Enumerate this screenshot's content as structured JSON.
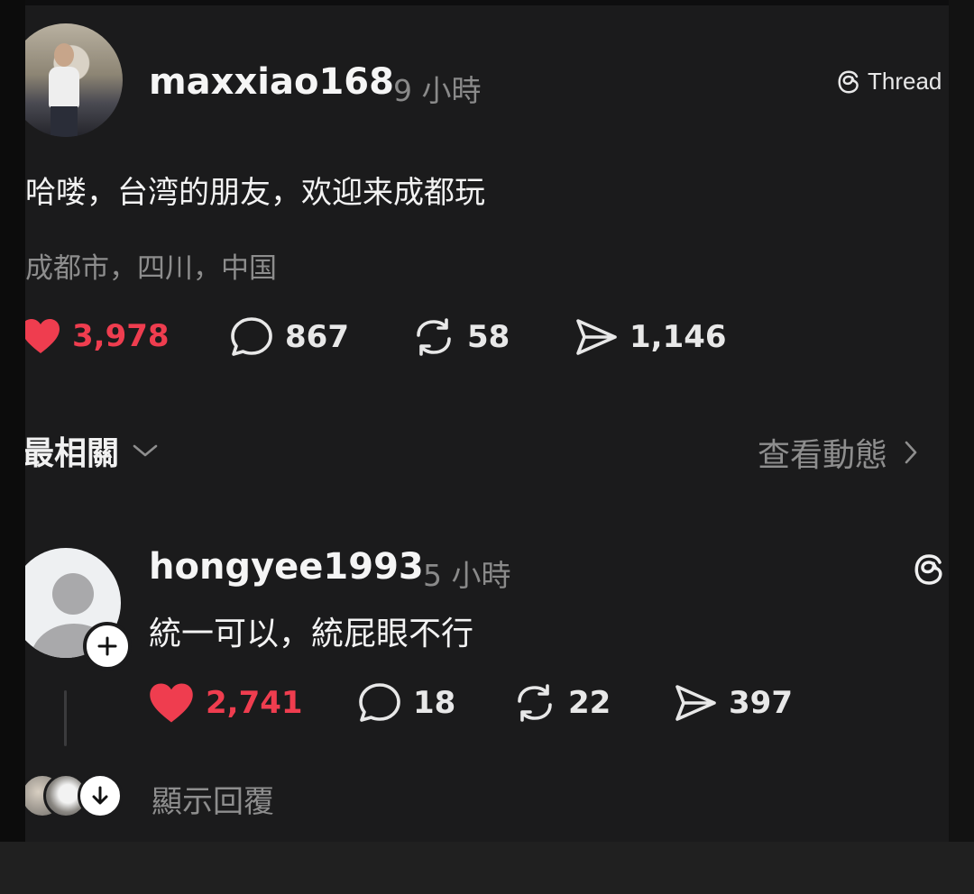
{
  "post": {
    "username": "maxxiao168",
    "time": "9 小時",
    "badge_label": "Thread",
    "text": "哈喽，台湾的朋友，欢迎来成都玩",
    "location": "成都市，四川，中国",
    "stats": {
      "likes": "3,978",
      "comments": "867",
      "reposts": "58",
      "shares": "1,146"
    }
  },
  "sort": {
    "label": "最相關",
    "view_activity": "查看動態"
  },
  "comment": {
    "username": "hongyee1993",
    "time": "5 小時",
    "text": "統一可以，統屁眼不行",
    "stats": {
      "likes": "2,741",
      "comments": "18",
      "reposts": "22",
      "shares": "397"
    },
    "show_replies": "顯示回覆"
  },
  "colors": {
    "background": "#1b1b1c",
    "like_red": "#ef3d4f",
    "muted_text": "#8d8d8d"
  }
}
